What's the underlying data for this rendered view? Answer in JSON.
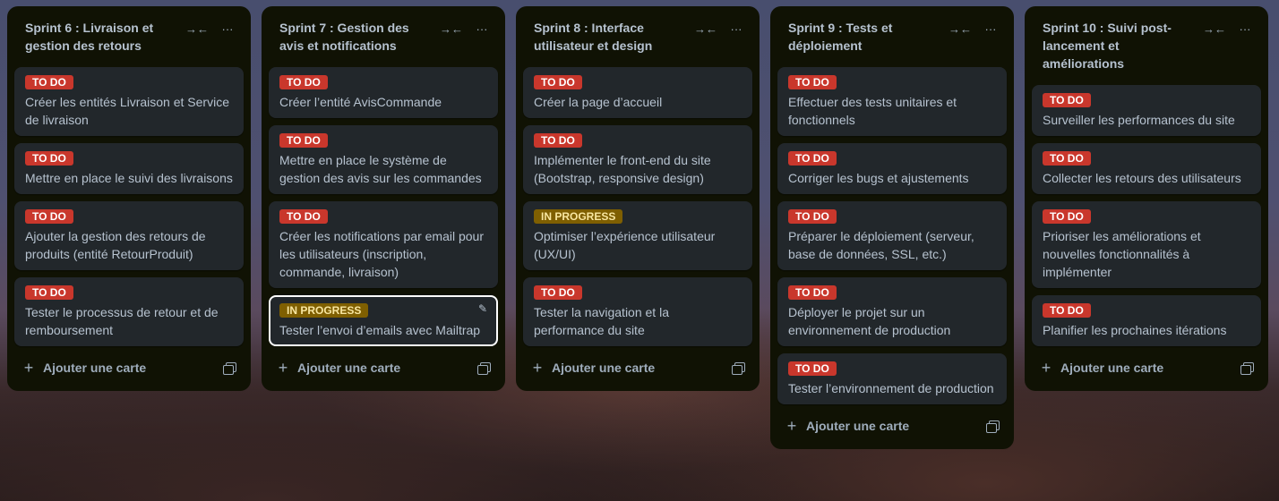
{
  "lists": [
    {
      "title": "Sprint 6 : Livraison et gestion des retours",
      "cards": [
        {
          "status": "TO DO",
          "text": "Créer les entités Livraison et Service de livraison"
        },
        {
          "status": "TO DO",
          "text": "Mettre en place le suivi des livraisons"
        },
        {
          "status": "TO DO",
          "text": "Ajouter la gestion des retours de produits (entité RetourProduit)"
        },
        {
          "status": "TO DO",
          "text": "Tester le processus de retour et de remboursement"
        }
      ],
      "add_label": "Ajouter une carte"
    },
    {
      "title": "Sprint 7 : Gestion des avis et notifications",
      "cards": [
        {
          "status": "TO DO",
          "text": "Créer l’entité AvisCommande"
        },
        {
          "status": "TO DO",
          "text": "Mettre en place le système de gestion des avis sur les commandes"
        },
        {
          "status": "TO DO",
          "text": "Créer les notifications par email pour les utilisateurs (inscription, commande, livraison)"
        },
        {
          "status": "IN PROGRESS",
          "text": "Tester l’envoi d’emails avec Mailtrap"
        }
      ],
      "add_label": "Ajouter une carte"
    },
    {
      "title": "Sprint 8 : Interface utilisateur et design",
      "cards": [
        {
          "status": "TO DO",
          "text": "Créer la page d’accueil"
        },
        {
          "status": "TO DO",
          "text": "Implémenter le front-end du site (Bootstrap, responsive design)"
        },
        {
          "status": "IN PROGRESS",
          "text": "Optimiser l’expérience utilisateur (UX/UI)"
        },
        {
          "status": "TO DO",
          "text": "Tester la navigation et la performance du site"
        }
      ],
      "add_label": "Ajouter une carte"
    },
    {
      "title": "Sprint 9 : Tests et déploiement",
      "cards": [
        {
          "status": "TO DO",
          "text": "Effectuer des tests unitaires et fonctionnels"
        },
        {
          "status": "TO DO",
          "text": "Corriger les bugs et ajustements"
        },
        {
          "status": "TO DO",
          "text": "Préparer le déploiement (serveur, base de données, SSL, etc.)"
        },
        {
          "status": "TO DO",
          "text": "Déployer le projet sur un environnement de production"
        },
        {
          "status": "TO DO",
          "text": "Tester l’environnement de production"
        }
      ],
      "add_label": "Ajouter une carte"
    },
    {
      "title": "Sprint 10 : Suivi post-lancement et améliorations",
      "cards": [
        {
          "status": "TO DO",
          "text": "Surveiller les performances du site"
        },
        {
          "status": "TO DO",
          "text": "Collecter les retours des utilisateurs"
        },
        {
          "status": "TO DO",
          "text": "Prioriser les améliorations et nouvelles fonctionnalités à implémenter"
        },
        {
          "status": "TO DO",
          "text": "Planifier les prochaines itérations"
        }
      ],
      "add_label": "Ajouter une carte"
    }
  ],
  "icons": {
    "collapse": "collapse-arrows-icon",
    "more": "ellipsis-icon",
    "plus": "plus-icon",
    "template": "template-icon",
    "edit": "pencil-icon"
  },
  "colors": {
    "todo": "#c9372c",
    "in_progress": "#7f5f01",
    "list_bg": "#101204",
    "card_bg": "#22272b"
  }
}
